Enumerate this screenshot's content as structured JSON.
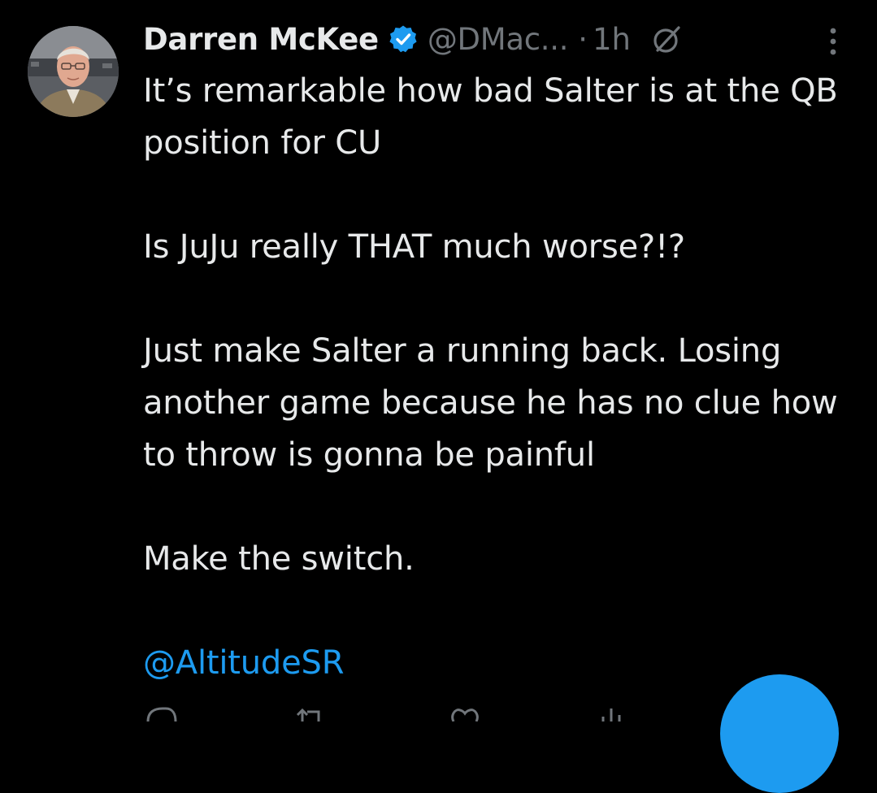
{
  "tweet": {
    "author": {
      "display_name": "Darren McKee",
      "handle": "@DMac...",
      "verified": true,
      "avatar": "profile-photo"
    },
    "separator": "·",
    "time": "1h",
    "paragraphs": [
      "It’s remarkable how bad Salter is at the QB position for CU",
      "Is JuJu really THAT much worse?!?",
      "Just make Salter a running back. Losing another game because he has no clue how to throw is gonna be painful",
      "Make the switch."
    ],
    "mention": "@AltitudeSR"
  },
  "icons": {
    "verified": "verified-badge-icon",
    "grok": "grok-icon",
    "more": "more-options-icon",
    "reply": "reply-icon",
    "retweet": "retweet-icon",
    "like": "like-icon",
    "views": "views-icon",
    "compose": "compose-button"
  },
  "colors": {
    "background": "#000000",
    "text": "#e7e9ea",
    "secondary": "#71767b",
    "accent": "#1d9bf0"
  }
}
